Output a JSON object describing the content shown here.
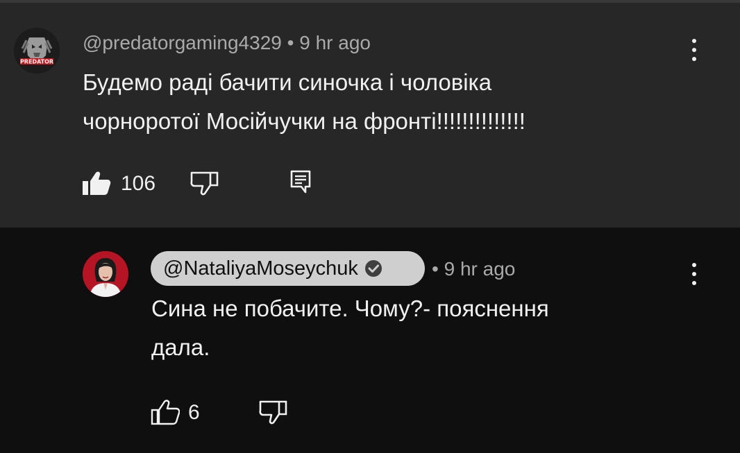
{
  "comments": [
    {
      "author": "@predatorgaming4329",
      "separator": "•",
      "time": "9 hr ago",
      "lines": [
        "Будемо раді бачити синочка і чоловіка",
        "чорноротої Мосійчучки на фронті!!!!!!!!!!!!!!"
      ],
      "likes": "106",
      "liked": true,
      "avatar_icon": "predator-avatar",
      "avatar_text": "PREDATOR"
    },
    {
      "author": "@NataliyaMoseychuk",
      "verified": true,
      "separator": "•",
      "time": "9 hr ago",
      "lines": [
        "Сина не побачите. Чому?- пояснення",
        "дала."
      ],
      "likes": "6",
      "liked": false,
      "avatar_icon": "woman-portrait-avatar"
    }
  ],
  "colors": {
    "highlight_bg": "#272727",
    "page_bg": "#0f0f0f",
    "text_primary": "#f1f1f1",
    "text_secondary": "#aaaaaa",
    "author_badge_bg": "#cfcfcf",
    "avatar2_bg": "#b41424"
  }
}
